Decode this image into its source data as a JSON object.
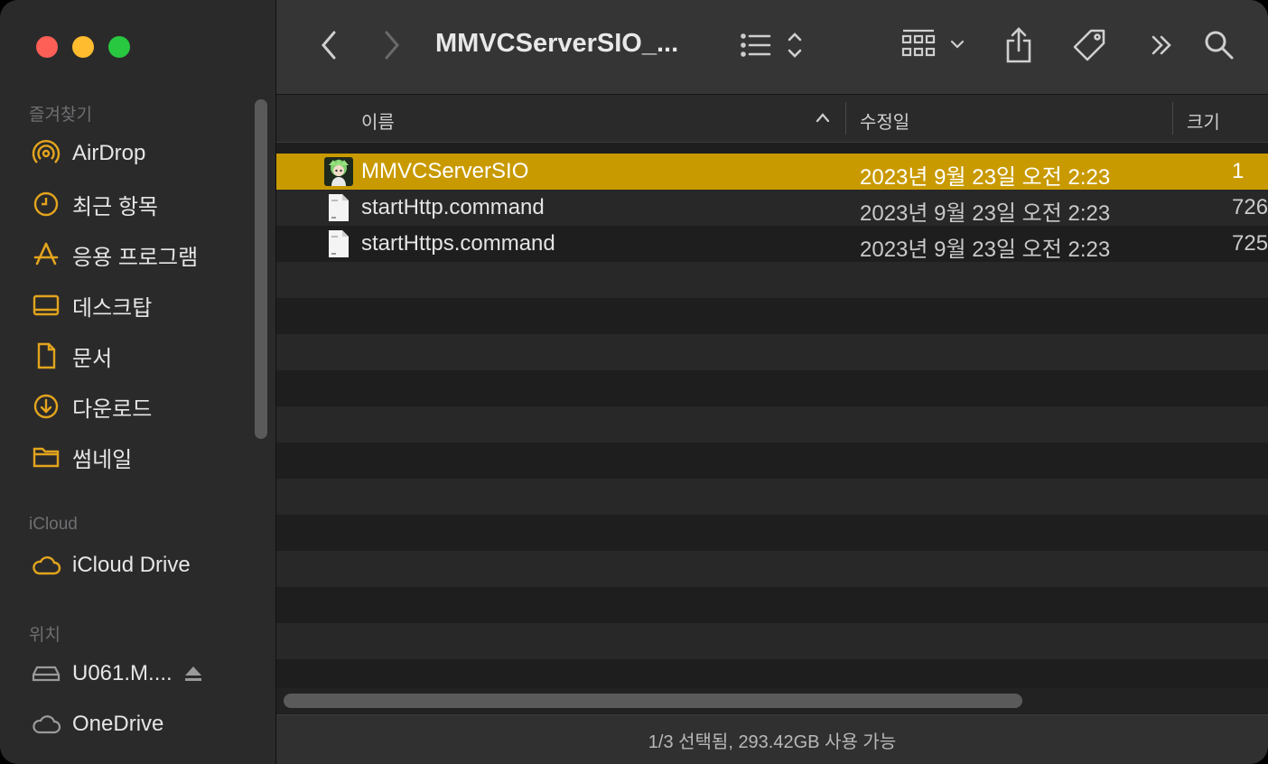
{
  "toolbar": {
    "title": "MMVCServerSIO_...",
    "back_icon": "chevron-left-icon",
    "forward_icon": "chevron-right-icon",
    "view_icon": "list-view-icon",
    "group_icon": "grid-group-icon",
    "share_icon": "share-icon",
    "tag_icon": "tag-icon",
    "more_icon": "double-chevron-right-icon",
    "search_icon": "search-icon"
  },
  "sidebar": {
    "favorites_title": "즐겨찾기",
    "favorites": [
      {
        "label": "AirDrop",
        "icon": "airdrop-icon"
      },
      {
        "label": "최근 항목",
        "icon": "clock-icon"
      },
      {
        "label": "응용 프로그램",
        "icon": "applications-icon"
      },
      {
        "label": "데스크탑",
        "icon": "desktop-icon"
      },
      {
        "label": "문서",
        "icon": "document-icon"
      },
      {
        "label": "다운로드",
        "icon": "download-icon"
      },
      {
        "label": "썸네일",
        "icon": "folder-icon"
      }
    ],
    "icloud_title": "iCloud",
    "icloud": [
      {
        "label": "iCloud Drive",
        "icon": "cloud-icon"
      }
    ],
    "locations_title": "위치",
    "locations": [
      {
        "label": "U061.M....",
        "icon": "drive-icon"
      },
      {
        "label": "OneDrive",
        "icon": "cloud-icon"
      }
    ]
  },
  "columns": {
    "name": "이름",
    "modified": "수정일",
    "size": "크기"
  },
  "files": [
    {
      "name": "MMVCServerSIO",
      "modified": "2023년 9월 23일 오전 2:23",
      "size": "1",
      "icon": "app-icon",
      "selected": true
    },
    {
      "name": "startHttp.command",
      "modified": "2023년 9월 23일 오전 2:23",
      "size": "726",
      "icon": "file-icon",
      "selected": false
    },
    {
      "name": "startHttps.command",
      "modified": "2023년 9월 23일 오전 2:23",
      "size": "725",
      "icon": "file-icon",
      "selected": false
    }
  ],
  "status": {
    "text": "1/3 선택됨, 293.42GB 사용 가능"
  },
  "colors": {
    "accent": "#c99a00",
    "sidebar_icon": "#e3a51d"
  }
}
